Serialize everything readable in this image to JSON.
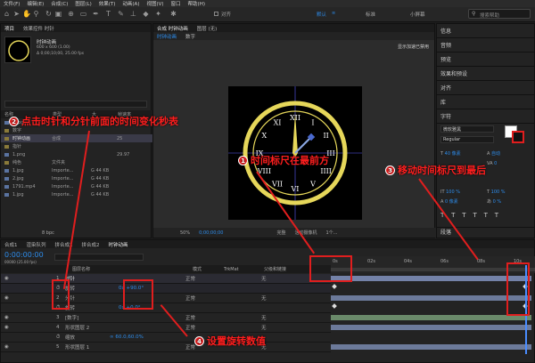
{
  "menu": [
    "文件(F)",
    "编辑(E)",
    "合成(C)",
    "图层(L)",
    "效果(T)",
    "动画(A)",
    "视图(V)",
    "窗口",
    "帮助(H)"
  ],
  "toolbar": {
    "align_label": "对齐",
    "workspace_default": "默认",
    "workspace_standard": "标准",
    "workspace_small": "小屏幕",
    "search_placeholder": "搜索帮助"
  },
  "project": {
    "tab_project": "项目",
    "tab_effects": "效果控件 时针",
    "comp_name": "时钟动画",
    "comp_info1": "600 x 600 (1.00)",
    "comp_info2": "Δ 0;00;10;00, 25.00 fps",
    "col_name": "名称",
    "col_type": "类型",
    "col_size": "大",
    "col_fps": "帧速率",
    "items": [
      {
        "name": "1.jpg",
        "type": "",
        "size": "",
        "fps": ""
      },
      {
        "name": "数字",
        "type": "",
        "size": "",
        "fps": ""
      },
      {
        "name": "时钟动画",
        "type": "合成",
        "size": "",
        "fps": "25"
      },
      {
        "name": "指针",
        "type": "",
        "size": "",
        "fps": ""
      },
      {
        "name": "1.png",
        "type": "",
        "size": "",
        "fps": "29.97"
      },
      {
        "name": "纯色",
        "type": "文件夹",
        "size": "",
        "fps": ""
      },
      {
        "name": "1.jpg",
        "type": "Importe...",
        "size": "G 44 KB",
        "fps": ""
      },
      {
        "name": "2.jpg",
        "type": "Importe...",
        "size": "G 44 KB",
        "fps": ""
      },
      {
        "name": "1791.mp4",
        "type": "Importe...",
        "size": "G 44 KB",
        "fps": ""
      },
      {
        "name": "1.jpg",
        "type": "Importe...",
        "size": "G 44 KB",
        "fps": ""
      }
    ],
    "bpc": "8 bpc"
  },
  "viewer": {
    "tab_comp": "合成 时钟动画",
    "tab_layer": "图层 (无)",
    "sub_tab1": "时钟动画",
    "sub_tab2": "数字",
    "notice": "显示加速已禁用",
    "zoom": "50%",
    "timecode": "0;00;00;00",
    "quality": "完整",
    "camera": "活动摄像机",
    "views": "1个...",
    "numerals": [
      "XII",
      "I",
      "II",
      "III",
      "IIII",
      "V",
      "VI",
      "VII",
      "VIII",
      "IX",
      "X",
      "XI"
    ]
  },
  "right_panel": {
    "items": [
      "信息",
      "音频",
      "预览",
      "效果和预设",
      "对齐",
      "库",
      "字符"
    ],
    "font": "微软雅黑",
    "style": "Regular",
    "font_size": "40 像素",
    "leading": "自动",
    "tracking": "0",
    "scale_v": "100 %",
    "scale_h": "100 %",
    "baseline": "0 像素",
    "tsume": "0 %",
    "paragraph": "段落"
  },
  "timeline": {
    "tabs": [
      "合成1",
      "渲染队列",
      "拼合成1",
      "拼合成2",
      "时钟动画"
    ],
    "timecode": "0:00:00:00",
    "timecode_sub": "00000 (25.00 fps)",
    "col_name": "图层名称",
    "col_mode": "模式",
    "col_trkmat": "TrkMat",
    "col_parent": "父级和链接",
    "ruler": [
      "0s",
      "02s",
      "04s",
      "06s",
      "08s",
      "10s"
    ],
    "layers": [
      {
        "num": "1",
        "name": "时针",
        "mode": "正常",
        "parent": "无"
      },
      {
        "num": "",
        "name": "旋转",
        "value": "0x +90.0°",
        "mode": "",
        "parent": ""
      },
      {
        "num": "2",
        "name": "分针",
        "mode": "正常",
        "parent": "无"
      },
      {
        "num": "",
        "name": "旋转",
        "value": "0x +0.0°",
        "mode": "",
        "parent": ""
      },
      {
        "num": "3",
        "name": "[数字]",
        "mode": "正常",
        "parent": "无"
      },
      {
        "num": "4",
        "name": "形状图层 2",
        "mode": "正常",
        "parent": "无"
      },
      {
        "num": "",
        "name": "缩放",
        "value": "∞ 60.0,60.0%",
        "mode": "",
        "parent": ""
      },
      {
        "num": "5",
        "name": "形状图层 1",
        "mode": "正常",
        "parent": "无"
      }
    ]
  },
  "annotations": {
    "a1": "时间标尺在最前方",
    "a2": "点击时针和分针前面的时间变化秒表",
    "a3": "移动时间标尺到最后",
    "a4": "设置旋转数值",
    "n1": "1",
    "n2": "2",
    "n3": "3",
    "n4": "4"
  },
  "colors": {
    "accent": "#2d8ceb",
    "annotation": "#e01e1e",
    "clock_gold": "#e6d75a",
    "playhead": "#4a8cff"
  }
}
